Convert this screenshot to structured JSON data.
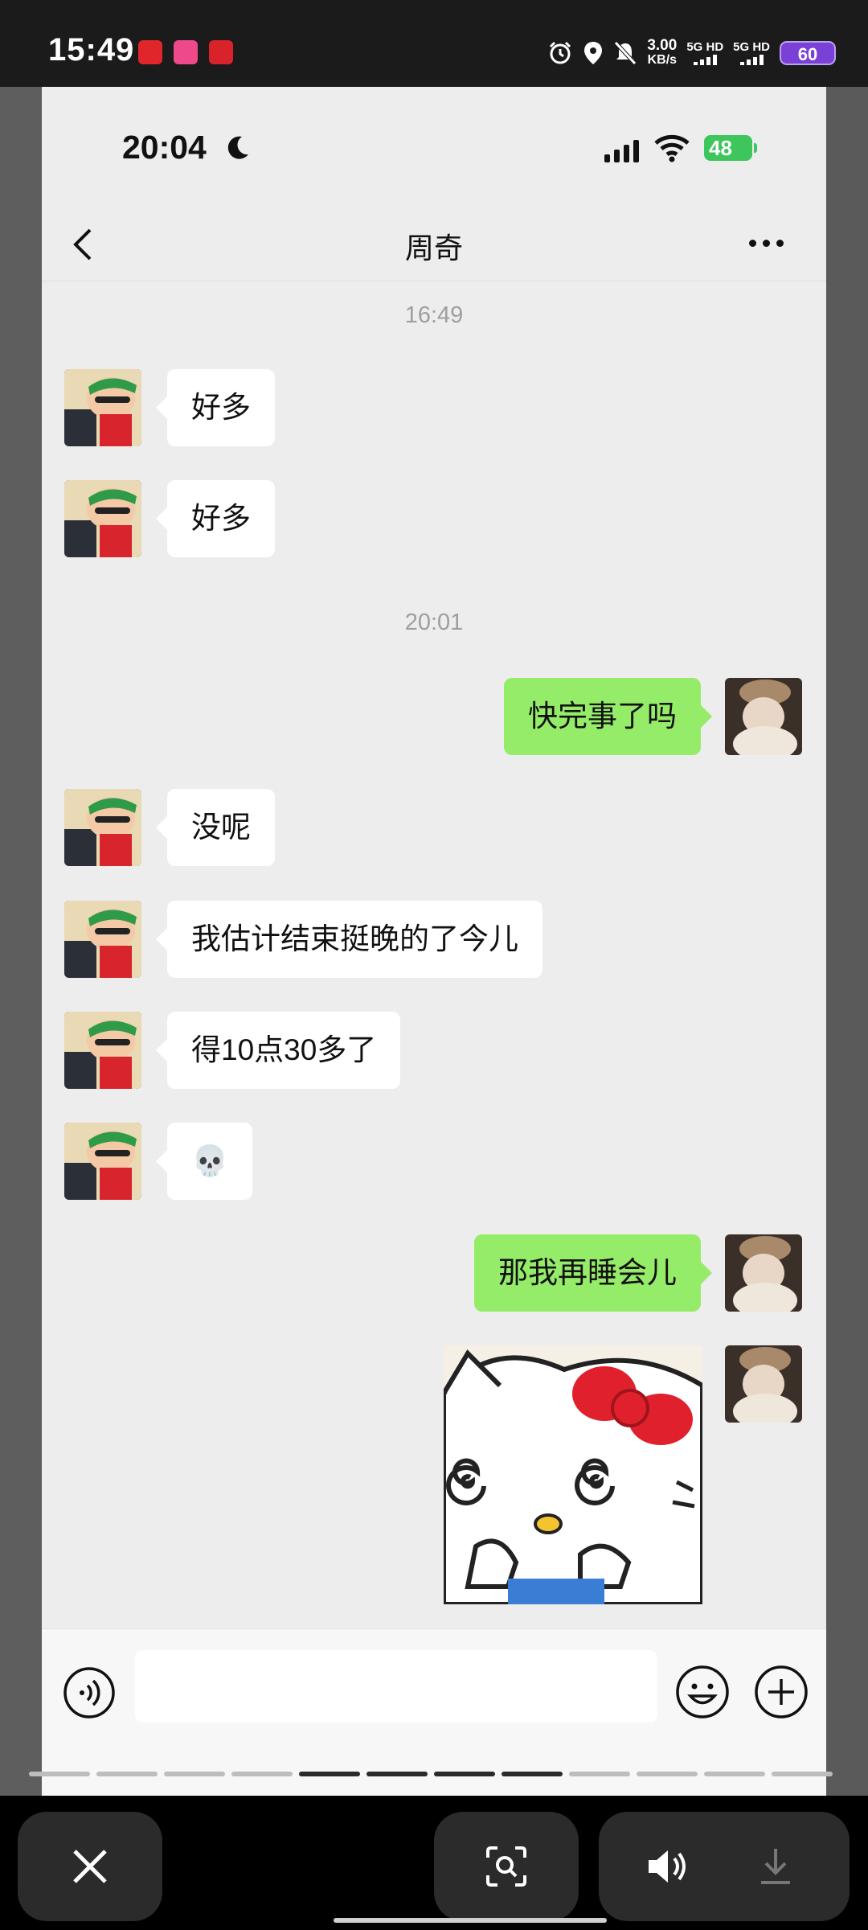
{
  "system_status": {
    "time": "15:49",
    "net_speed_value": "3.00",
    "net_speed_unit": "KB/s",
    "sim1": "5G HD",
    "sim2": "5G HD",
    "battery": "60"
  },
  "inner_status": {
    "time": "20:04",
    "battery": "48"
  },
  "chat": {
    "title": "周奇",
    "timestamps": [
      "16:49",
      "20:01"
    ],
    "messages": [
      {
        "from": "friend",
        "text": "好多"
      },
      {
        "from": "friend",
        "text": "好多"
      },
      {
        "from": "me",
        "text": "快完事了吗"
      },
      {
        "from": "friend",
        "text": "没呢"
      },
      {
        "from": "friend",
        "text": "我估计结束挺晚的了今儿"
      },
      {
        "from": "friend",
        "text": "得10点30多了"
      },
      {
        "from": "friend",
        "text": "💀"
      },
      {
        "from": "me",
        "text": "那我再睡会儿"
      },
      {
        "from": "me",
        "type": "sticker",
        "sticker": "hello-kitty-dizzy"
      }
    ]
  },
  "input": {
    "placeholder": ""
  },
  "icons": {
    "back": "chevron-left-icon",
    "more": "more-dots-icon",
    "voice": "voice-icon",
    "emoji": "emoji-icon",
    "plus": "plus-icon",
    "close": "close-icon",
    "lens": "lens-search-icon",
    "volume": "volume-icon",
    "download": "download-icon"
  },
  "colors": {
    "chat_bg": "#ededed",
    "out_bubble": "#95ec69",
    "in_bubble": "#ffffff",
    "battery_purple": "#7b40d8",
    "battery_green": "#3cc65c"
  }
}
